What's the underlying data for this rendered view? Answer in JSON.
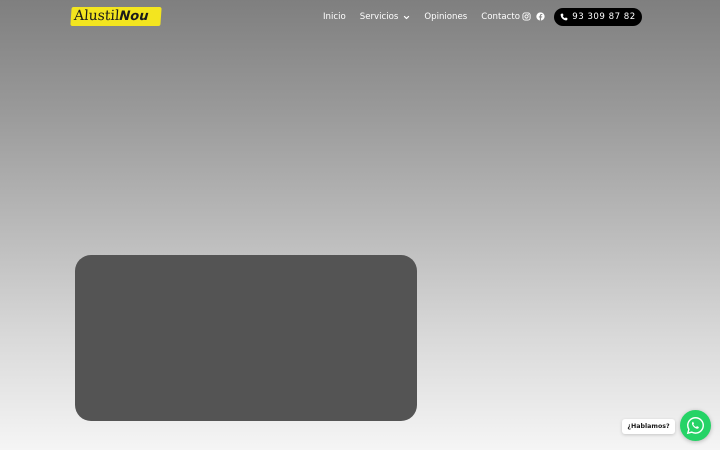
{
  "header": {
    "logo": {
      "part1": "Alustil",
      "part2": "Nou"
    },
    "nav": {
      "items": [
        {
          "label": "Inicio"
        },
        {
          "label": "Servicios",
          "icon": "chevron-down-icon"
        },
        {
          "label": "Opiniones"
        },
        {
          "label": "Contacto"
        }
      ]
    },
    "social": {
      "icons": [
        "instagram-icon",
        "facebook-icon"
      ]
    },
    "phone": {
      "label": "93 309 87 82",
      "icon": "phone-icon"
    }
  },
  "chat": {
    "bubble_label": "¿Hablamos?",
    "icon": "whatsapp-icon"
  },
  "colors": {
    "logo_bg": "#f3e51f",
    "phone_bg": "#000000",
    "video_card": "#545454",
    "whatsapp": "#25d366"
  }
}
